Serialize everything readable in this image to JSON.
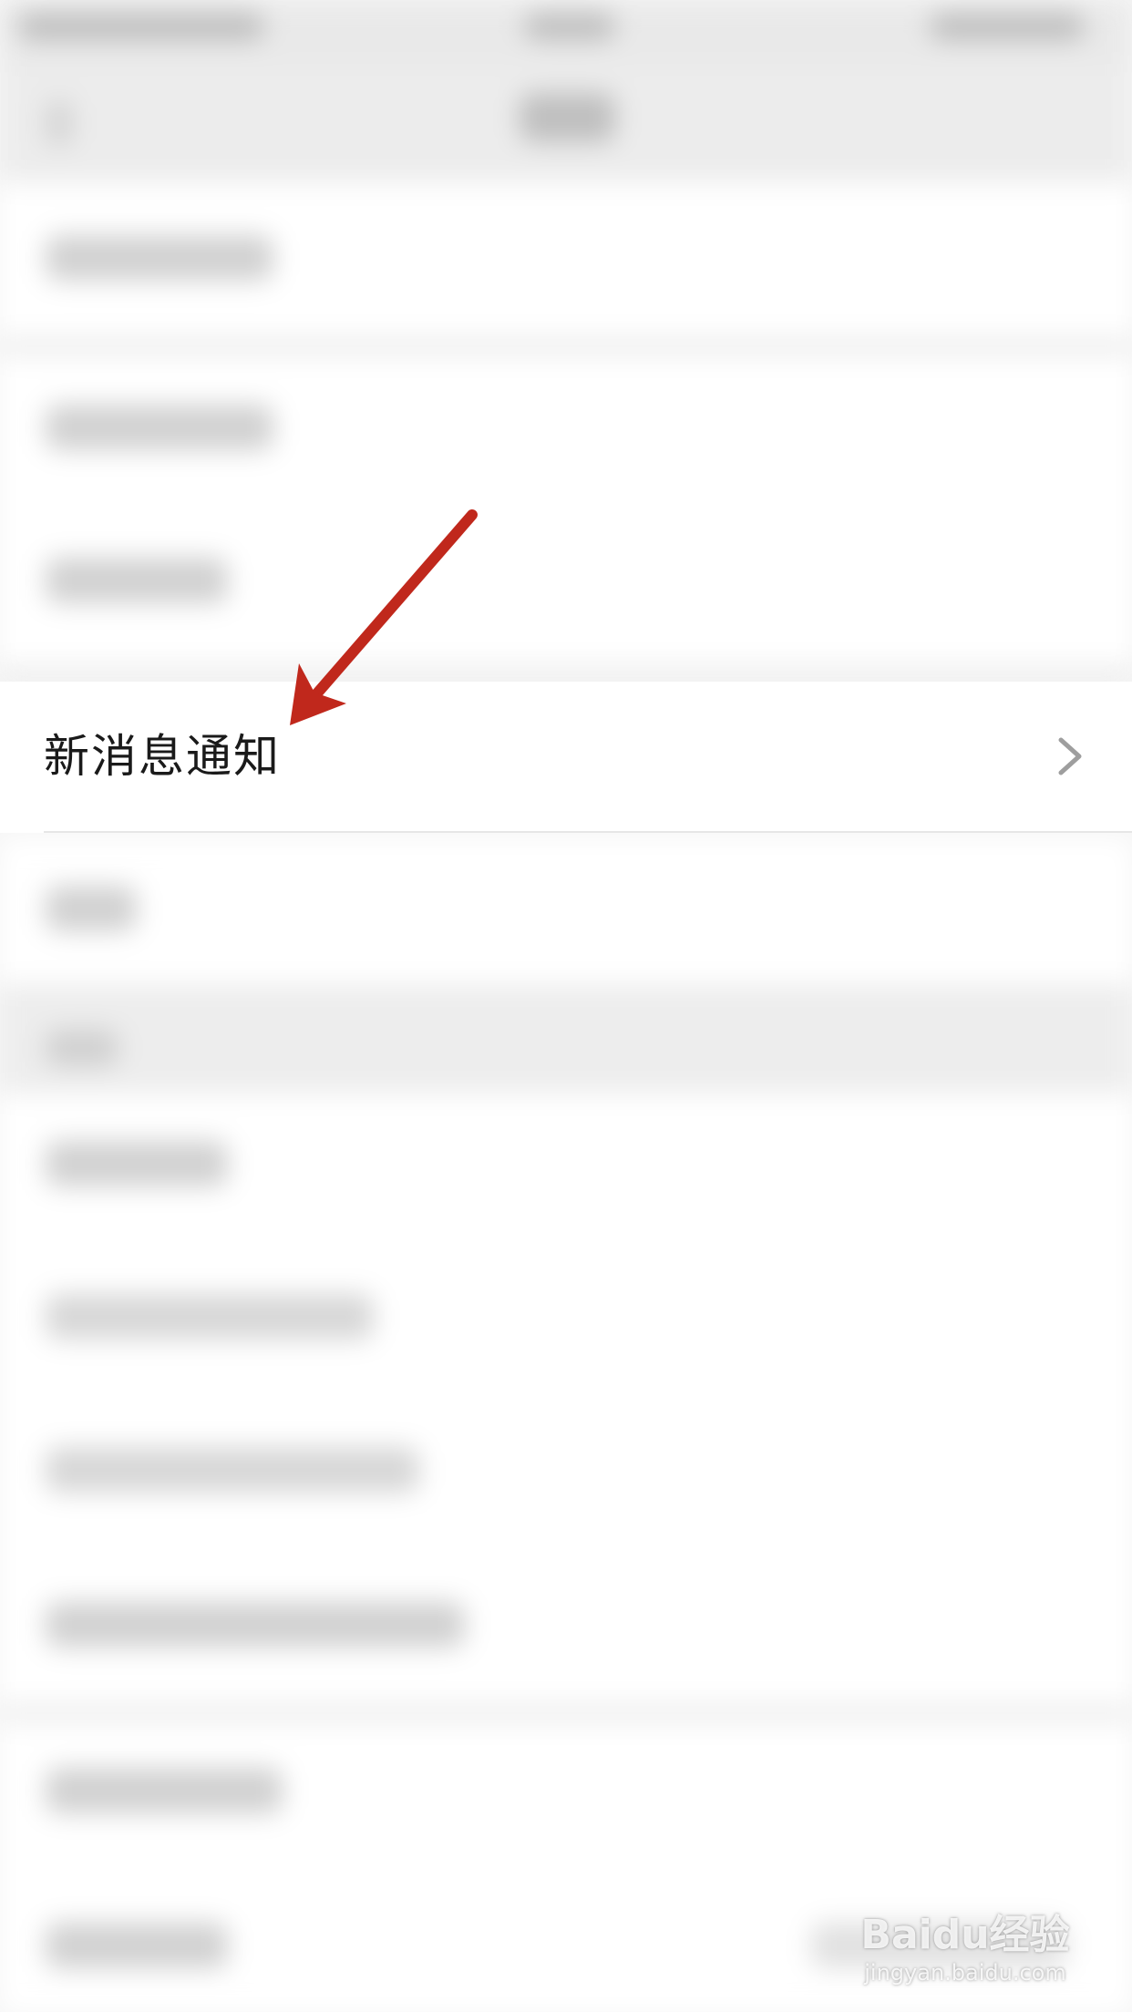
{
  "settings_list": {
    "focused_item": {
      "label": "新消息通知",
      "chevron_icon": "chevron-right-icon"
    }
  },
  "annotation": {
    "arrow_color": "#c0281c"
  },
  "watermark": {
    "main": "Baidu经验",
    "sub": "jingyan.baidu.com"
  },
  "colors": {
    "row_background": "#ffffff",
    "page_background": "#f3f3f3",
    "label_text": "#1a1a1a",
    "chevron": "#9e9e9e"
  }
}
